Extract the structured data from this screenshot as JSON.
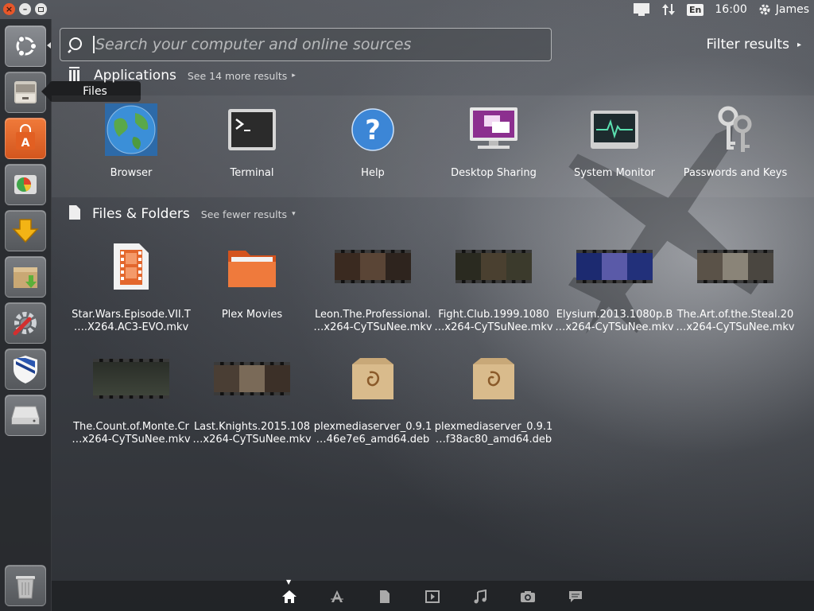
{
  "top_panel": {
    "time": "16:00",
    "user": "James",
    "lang": "En"
  },
  "tooltip": "Files",
  "search": {
    "placeholder": "Search your computer and online sources",
    "value": ""
  },
  "filter_label": "Filter results",
  "applications": {
    "title": "Applications",
    "more": "See 14 more results",
    "items": [
      {
        "label": "Browser",
        "icon": "globe-icon"
      },
      {
        "label": "Terminal",
        "icon": "terminal-icon"
      },
      {
        "label": "Help",
        "icon": "help-icon"
      },
      {
        "label": "Desktop Sharing",
        "icon": "desktop-sharing-icon"
      },
      {
        "label": "System Monitor",
        "icon": "system-monitor-icon"
      },
      {
        "label": "Passwords and Keys",
        "icon": "keys-icon"
      }
    ]
  },
  "files": {
    "title": "Files & Folders",
    "more": "See fewer results",
    "items": [
      {
        "line1": "Star.Wars.Episode.VII.T",
        "line2": "….X264.AC3-EVO.mkv",
        "icon": "video-file-icon"
      },
      {
        "line1": "Plex Movies",
        "line2": "",
        "icon": "folder-icon"
      },
      {
        "line1": "Leon.The.Professional.",
        "line2": "…x264-CyTSuNee.mkv",
        "icon": "video-thumbnail"
      },
      {
        "line1": "Fight.Club.1999.1080",
        "line2": "…x264-CyTSuNee.mkv",
        "icon": "video-thumbnail"
      },
      {
        "line1": "Elysium.2013.1080p.B",
        "line2": "…x264-CyTSuNee.mkv",
        "icon": "video-thumbnail"
      },
      {
        "line1": "The.Art.of.the.Steal.20",
        "line2": "…x264-CyTSuNee.mkv",
        "icon": "video-thumbnail"
      },
      {
        "line1": "The.Count.of.Monte.Cr",
        "line2": "…x264-CyTSuNee.mkv",
        "icon": "video-thumbnail"
      },
      {
        "line1": "Last.Knights.2015.108",
        "line2": "…x264-CyTSuNee.mkv",
        "icon": "video-thumbnail"
      },
      {
        "line1": "plexmediaserver_0.9.1",
        "line2": "…46e7e6_amd64.deb",
        "icon": "deb-package-icon"
      },
      {
        "line1": "plexmediaserver_0.9.1",
        "line2": "…f38ac80_amd64.deb",
        "icon": "deb-package-icon"
      }
    ]
  },
  "launcher": [
    "dash-home-icon",
    "files-icon",
    "software-center-icon",
    "disk-usage-icon",
    "downloads-icon",
    "archive-manager-icon",
    "system-settings-icon",
    "shield-icon",
    "drive-icon",
    "trash-icon"
  ],
  "lenses": [
    "home-lens-icon",
    "applications-lens-icon",
    "files-lens-icon",
    "video-lens-icon",
    "music-lens-icon",
    "photo-lens-icon",
    "social-lens-icon"
  ],
  "colors": {
    "close": "#e8572a",
    "accent_orange": "#e8572a"
  }
}
